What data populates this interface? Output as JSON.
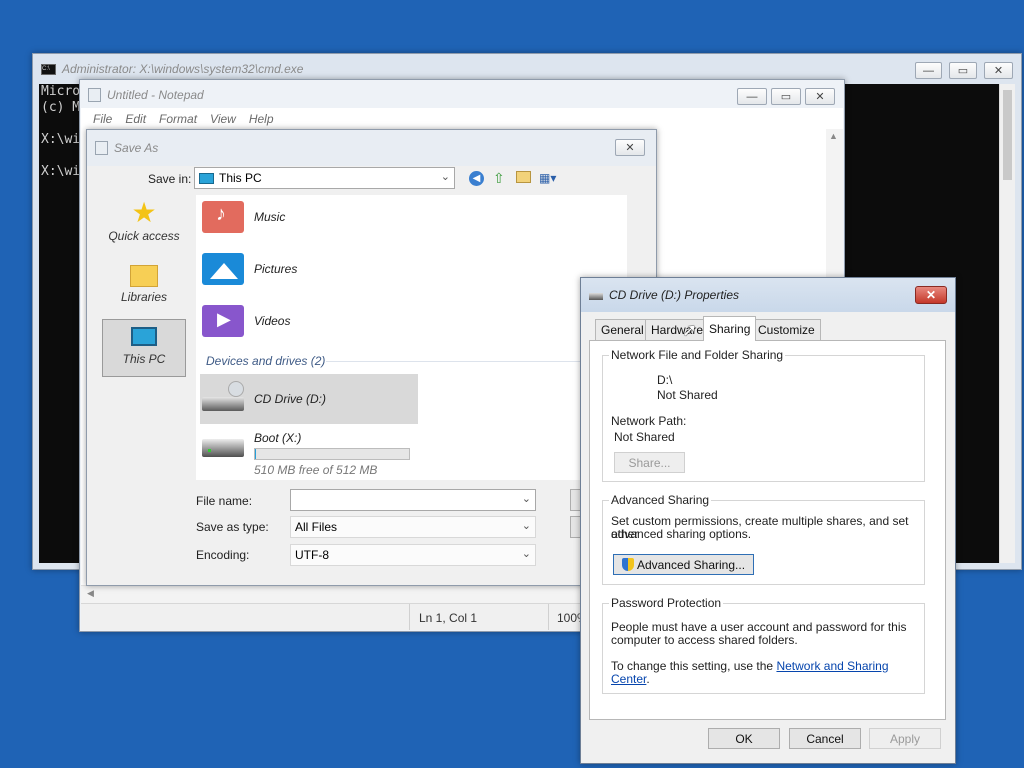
{
  "cmd": {
    "title": "Administrator: X:\\windows\\system32\\cmd.exe",
    "lines": [
      "Micro",
      "(c) M",
      "",
      "X:\\wi",
      "",
      "X:\\wi"
    ]
  },
  "notepad": {
    "title": "Untitled - Notepad",
    "menu": [
      "File",
      "Edit",
      "Format",
      "View",
      "Help"
    ],
    "status_pos": "Ln 1, Col 1",
    "status_zoom": "100%"
  },
  "saveas": {
    "title": "Save As",
    "save_in_label": "Save in:",
    "save_in_value": "This PC",
    "places": [
      "Quick access",
      "Libraries",
      "This PC"
    ],
    "folders": [
      "Music",
      "Pictures",
      "Videos"
    ],
    "devices_header": "Devices and drives (2)",
    "drives": [
      {
        "name": "CD Drive (D:)",
        "detail": ""
      },
      {
        "name": "Boot (X:)",
        "detail": "510 MB free of 512 MB",
        "used_fraction": 0.004
      }
    ],
    "file_name_label": "File name:",
    "file_name_value": "",
    "type_label": "Save as type:",
    "type_value": "All Files",
    "encoding_label": "Encoding:",
    "encoding_value": "UTF-8"
  },
  "props": {
    "title": "CD Drive (D:) Properties",
    "tabs": [
      "General",
      "Hardware",
      "Sharing",
      "Customize"
    ],
    "nffs_title": "Network File and Folder Sharing",
    "path": "D:\\",
    "shared_state": "Not Shared",
    "netpath_label": "Network Path:",
    "netpath_value": "Not Shared",
    "share_btn": "Share...",
    "adv_title": "Advanced Sharing",
    "adv_text1": "Set custom permissions, create multiple shares, and set other",
    "adv_text2": "advanced sharing options.",
    "adv_btn": "Advanced Sharing...",
    "pw_title": "Password Protection",
    "pw_text1": "People must have a user account and password for this",
    "pw_text2": "computer to access shared folders.",
    "pw_text3": "To change this setting, use the",
    "pw_link": "Network and Sharing Center",
    "pw_end": ".",
    "ok": "OK",
    "cancel": "Cancel",
    "apply": "Apply"
  }
}
